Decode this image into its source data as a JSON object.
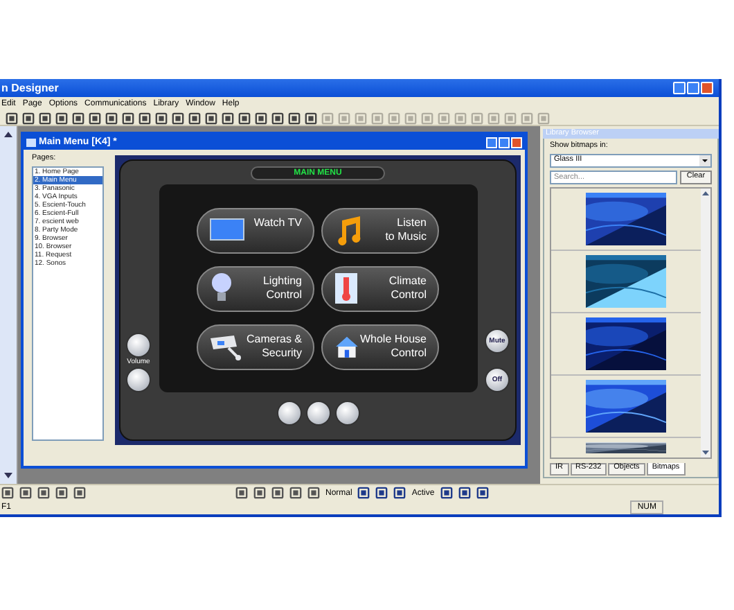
{
  "window": {
    "title": "n Designer"
  },
  "menu": [
    "Edit",
    "Page",
    "Options",
    "Communications",
    "Library",
    "Window",
    "Help"
  ],
  "child_window": {
    "title": "Main Menu [K4] *"
  },
  "pages": {
    "label": "Pages:",
    "items": [
      {
        "label": "1. Home Page",
        "selected": false
      },
      {
        "label": "2. Main Menu",
        "selected": true
      },
      {
        "label": "3. Panasonic",
        "selected": false
      },
      {
        "label": "4. VGA Inputs",
        "selected": false
      },
      {
        "label": "5. Escient-Touch",
        "selected": false
      },
      {
        "label": "6. Escient-Full",
        "selected": false
      },
      {
        "label": "7. escient web",
        "selected": false
      },
      {
        "label": "8. Party Mode",
        "selected": false
      },
      {
        "label": "9. Browser",
        "selected": false
      },
      {
        "label": "10. Browser",
        "selected": false
      },
      {
        "label": "11. Request",
        "selected": false
      },
      {
        "label": "12. Sonos",
        "selected": false
      }
    ]
  },
  "touch_panel": {
    "title": "MAIN MENU",
    "buttons": [
      {
        "kind": "tv",
        "lines": [
          "Watch TV"
        ]
      },
      {
        "kind": "music",
        "lines": [
          "Listen",
          "to Music"
        ]
      },
      {
        "kind": "bulb",
        "lines": [
          "Lighting",
          "Control"
        ]
      },
      {
        "kind": "thermo",
        "lines": [
          "Climate",
          "Control"
        ]
      },
      {
        "kind": "camera",
        "lines": [
          "Cameras &",
          "Security"
        ]
      },
      {
        "kind": "house",
        "lines": [
          "Whole House",
          "Control"
        ]
      }
    ],
    "volume_label": "Volume",
    "mute_label": "Mute",
    "off_label": "Off"
  },
  "library_browser": {
    "title": "Library Browser",
    "show_label": "Show bitmaps in:",
    "folder": "Glass III",
    "search": {
      "placeholder": "Search..."
    },
    "clear_button": "Clear",
    "tabs": [
      {
        "label": "IR",
        "selected": false
      },
      {
        "label": "RS-232",
        "selected": false
      },
      {
        "label": "Objects",
        "selected": false
      },
      {
        "label": "Bitmaps",
        "selected": true
      }
    ]
  },
  "format_toolbar": {
    "normal_label": "Normal",
    "active_label": "Active"
  },
  "status_bar": {
    "left": "F1",
    "num": "NUM"
  }
}
